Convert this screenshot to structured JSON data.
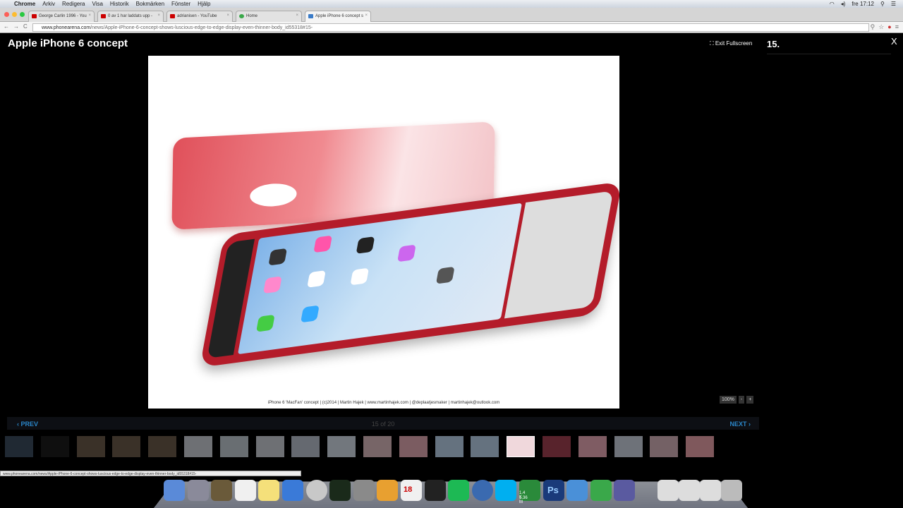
{
  "menubar": {
    "app": "Chrome",
    "items": [
      "Arkiv",
      "Redigera",
      "Visa",
      "Historik",
      "Bokmärken",
      "Fönster",
      "Hjälp"
    ],
    "clock": "fre 17:12"
  },
  "tabs": [
    {
      "label": "George Carlin 1996 - You",
      "color": "#cc1a1a"
    },
    {
      "label": "0 av 1 har laddats upp -",
      "color": "#cc1a1a"
    },
    {
      "label": "adrianisen - YouTube",
      "color": "#cc1a1a"
    },
    {
      "label": "Home",
      "color": "#3aa84a"
    },
    {
      "label": "Apple iPhone 6 concept s",
      "color": "#3a7bc8"
    }
  ],
  "url": {
    "domain": "www.phonearena.com",
    "path": "/news/Apple-iPhone-6-concept-shows-luscious-edge-to-edge-display-even-thinner-body_id55318#15-"
  },
  "gallery": {
    "title": "Apple iPhone 6 concept",
    "exit": "Exit Fullscreen",
    "index_label": "15.",
    "close": "X",
    "caption": "iPhone 6 'MacFan' concept  |  (c)2014  |  Martin Hajek  |  www.martinhajek.com  |  @deplaatjesmaker  |  martinhajek@outlook.com",
    "zoom": "100%",
    "zoom_minus": "-",
    "zoom_plus": "+",
    "prev": "‹ PREV",
    "next": "NEXT ›",
    "count": "15 of 20",
    "active_thumb": 15,
    "thumb_colors": [
      "#3a4a5c",
      "#1c1c1c",
      "#6a5a48",
      "#6a5a48",
      "#6a5a48",
      "#c8ccd4",
      "#c0c8d0",
      "#c8ccd4",
      "#b8c0cc",
      "#d0d8e4",
      "#d8b8bc",
      "#e0a8b0",
      "#b8d0e8",
      "#b8d0e8",
      "#f0d8dc",
      "#a04050",
      "#e8a8b4",
      "#c8d0dc",
      "#d4b0b8",
      "#e8a0a8"
    ]
  },
  "status_url": "www.phonearena.com/news/Apple-iPhone-6-concept-shows-luscious-edge-to-edge-display-even-thinner-body_id55318#15-",
  "dock": {
    "calendar_day": "18",
    "net_up": "1.4 K",
    "net_down": "1.36 M",
    "ps": "Ps",
    "icon_colors": [
      "#5a8ad8",
      "#8a8a9a",
      "#6a5a3a",
      "#f0f0f0",
      "#f5e07a",
      "#3a7ad8",
      "#c8c8c8",
      "#1a2a1a",
      "#8a8a8a",
      "#e8a030",
      "#f0f0f0",
      "#222",
      "#1db954",
      "#3a6ab0",
      "#00aff0",
      "#2a8a3a",
      "#1a3a7a",
      "#4a90d8",
      "#3aa84a",
      "#5a5aa0"
    ]
  }
}
